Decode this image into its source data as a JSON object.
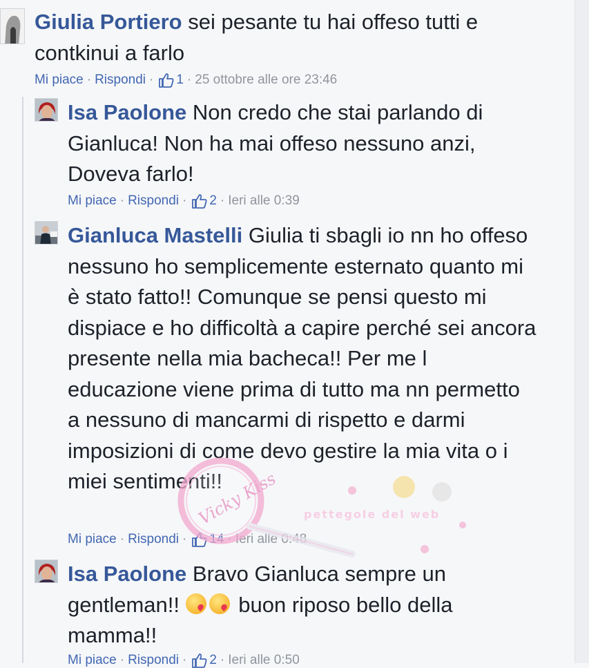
{
  "comments": [
    {
      "author": "Giulia Portiero",
      "text": "sei pesante tu hai offeso tutti e contkinui a farlo",
      "actions": {
        "like": "Mi piace",
        "reply": "Rispondi"
      },
      "likes": "1",
      "time": "25 ottobre alle ore 23:46"
    },
    {
      "author": "Isa Paolone",
      "text": "Non credo che stai parlando di Gianluca! Non ha mai offeso nessuno anzi, Doveva farlo!",
      "actions": {
        "like": "Mi piace",
        "reply": "Rispondi"
      },
      "likes": "2",
      "time": "Ieri alle 0:39"
    },
    {
      "author": "Gianluca Mastelli",
      "text": "Giulia ti sbagli io nn ho offeso nessuno ho semplicemente esternato quanto mi è stato fatto!! Comunque se pensi questo mi dispiace e ho difficoltà a capire perché sei ancora presente nella mia bacheca!! Per me l educazione viene prima di tutto ma nn permetto a nessuno di mancarmi di rispetto e darmi imposizioni di come devo gestire la mia vita o i miei sentimenti!!",
      "actions": {
        "like": "Mi piace",
        "reply": "Rispondi"
      },
      "likes": "14",
      "time": "Ieri alle 0:48"
    },
    {
      "author": "Isa Paolone",
      "text_before": "Bravo Gianluca sempre un gentleman!!",
      "text_after": "buon riposo bello della mamma!!",
      "emoji": "kissing-heart-emoji",
      "actions": {
        "like": "Mi piace",
        "reply": "Rispondi"
      },
      "likes": "2",
      "time": "Ieri alle 0:50"
    }
  ],
  "watermark": {
    "stamp_text": "Vicky Kiss",
    "banner_text": "pettegole del web"
  },
  "colors": {
    "author": "#365899",
    "link": "#4267b2",
    "meta": "#90949c",
    "text": "#1d2129",
    "background": "#f6f7f9"
  }
}
